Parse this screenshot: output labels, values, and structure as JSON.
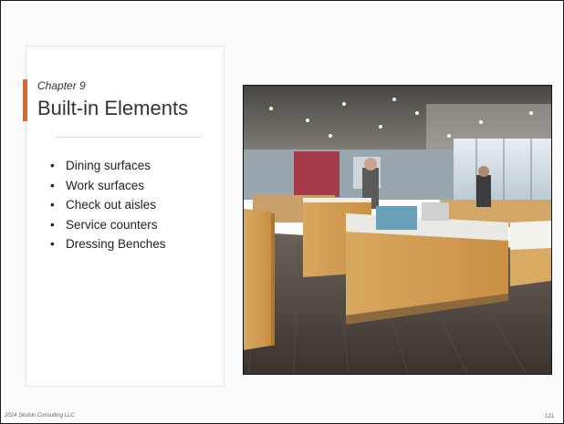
{
  "slide": {
    "chapter": "Chapter 9",
    "title": "Built-in Elements",
    "bullets": [
      "Dining surfaces",
      "Work surfaces",
      "Check out aisles",
      "Service counters",
      "Dressing Benches"
    ],
    "footer": "2024 Skulski Consulting LLC",
    "page_number": "121"
  },
  "colors": {
    "accent": "#e0652b"
  },
  "photo": {
    "icon": "retail-store-interior-photo"
  }
}
